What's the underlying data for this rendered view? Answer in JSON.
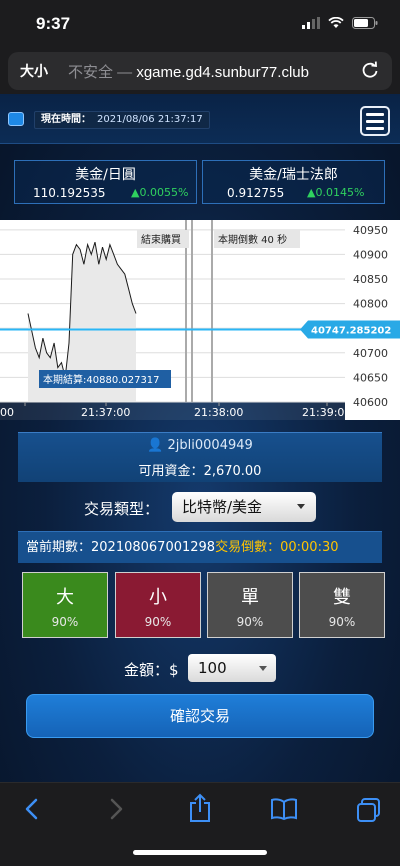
{
  "status_bar": {
    "time": "9:37"
  },
  "browser": {
    "aa_label": "大小",
    "insecure_label": "不安全 —",
    "url": "xgame.gd4.sunbur77.club"
  },
  "header": {
    "time_label": "現在時間：",
    "time_value": "2021/08/06 21:37:17"
  },
  "rates": [
    {
      "pair": "美金/日圓",
      "price": "110.192535",
      "change": "▲0.0055%"
    },
    {
      "pair": "美金/瑞士法郎",
      "price": "0.912755",
      "change": "▲0.0145%"
    }
  ],
  "chart": {
    "end_buy_label": "結束購買",
    "countdown_label": "本期倒數 40 秒",
    "settle_label": "本期結算:40880.027317",
    "current_price_label": "40747.285202",
    "y_ticks": [
      "40950",
      "40900",
      "40850",
      "40800",
      "40750",
      "40700",
      "40650",
      "40600"
    ],
    "x_ticks": [
      "00",
      "21:37:00",
      "21:38:00",
      "21:39:0"
    ]
  },
  "chart_data": {
    "type": "line",
    "series": [
      {
        "values": [
          40780,
          40745,
          40710,
          40690,
          40730,
          40700,
          40690,
          40720,
          40670,
          40680,
          40650,
          40720,
          40900,
          40920,
          40910,
          40880,
          40920,
          40900,
          40925,
          40880,
          40915,
          40890,
          40920,
          40900,
          40880,
          40870,
          40860,
          40830,
          40800,
          40780
        ]
      }
    ],
    "ylim": [
      40600,
      40970
    ],
    "y_ticks": [
      40950,
      40900,
      40850,
      40800,
      40750,
      40700,
      40650,
      40600
    ],
    "x_tick_labels": [
      "00",
      "21:37:00",
      "21:38:00",
      "21:39:0"
    ],
    "reference_lines": {
      "current_price": 40747.285202,
      "settle_price": 40880.027317
    },
    "annotations": [
      "結束購買",
      "本期倒數 40 秒",
      "本期結算:40880.027317"
    ]
  },
  "account": {
    "username": "2jbli0004949",
    "funds_label": "可用資金：",
    "funds_value": "2,670.00"
  },
  "trade": {
    "type_label": "交易類型：",
    "type_value": "比特幣/美金",
    "period_label": "當前期數：",
    "period_value": "202108067001298",
    "countdown_label": "交易倒數：",
    "countdown_value": "00:00:30"
  },
  "bets": [
    {
      "name": "大",
      "odds": "90%",
      "color": "#3a8a1d"
    },
    {
      "name": "小",
      "odds": "90%",
      "color": "#8a1a33"
    },
    {
      "name": "單",
      "odds": "90%",
      "color": "#4d4d4d"
    },
    {
      "name": "雙",
      "odds": "90%",
      "color": "#4d4d4d"
    }
  ],
  "amount": {
    "label": "金額：$",
    "value": "100"
  },
  "confirm_label": "確認交易"
}
